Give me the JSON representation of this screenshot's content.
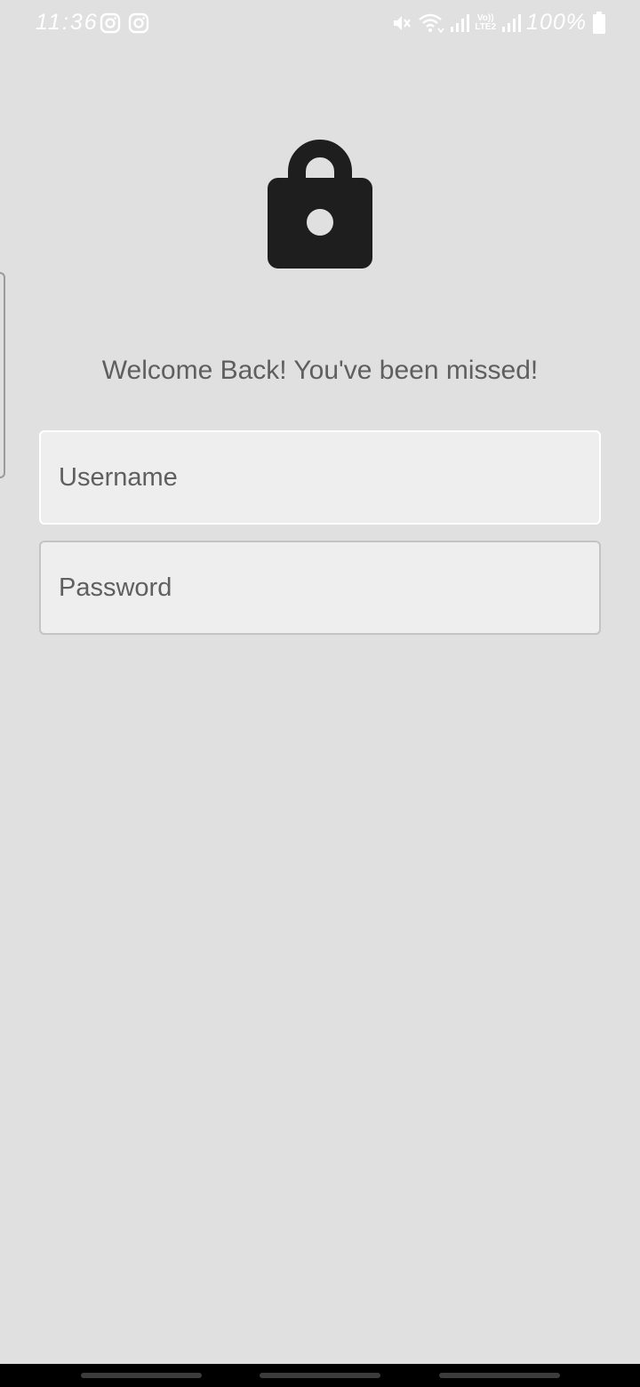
{
  "status_bar": {
    "time": "11:36",
    "notification_icons": [
      "instagram-icon",
      "instagram-icon"
    ],
    "system_icons": [
      "mute-icon",
      "wifi-icon",
      "signal-icon",
      "volte-lte2-icon",
      "signal-icon",
      "battery-icon"
    ],
    "lte_label_top": "Vo))",
    "lte_label_bottom": "LTE2",
    "battery": "100%"
  },
  "login": {
    "icon": "lock-icon",
    "welcome": "Welcome Back! You've been missed!",
    "username_placeholder": "Username",
    "password_placeholder": "Password"
  },
  "colors": {
    "background": "#e0e0e0",
    "field_background": "#eeeeee",
    "text": "#5f5f5f",
    "icon": "#1e1e1e"
  }
}
